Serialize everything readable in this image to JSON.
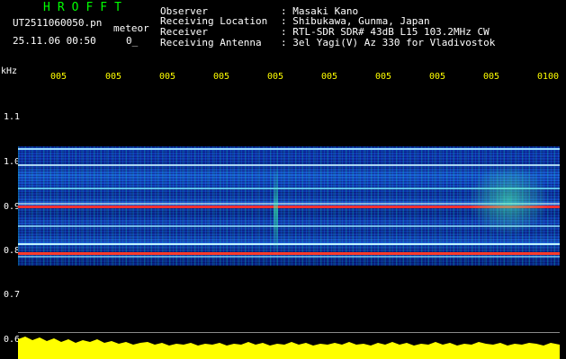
{
  "header": {
    "app_name": "HROFFT",
    "filename": "UT2511060050.pn",
    "mode": "meteor",
    "timestamp": "25.11.06 00:50",
    "count": "0_"
  },
  "station": {
    "rows": [
      {
        "label": "Observer",
        "value": ": Masaki Kano"
      },
      {
        "label": "Receiving Location",
        "value": ": Shibukawa, Gunma, Japan"
      },
      {
        "label": "Receiver",
        "value": ": RTL-SDR SDR# 43dB L15 103.2MHz CW"
      },
      {
        "label": "Receiving Antenna",
        "value": ": 3el Yagi(V) Az 330 for Vladivostok"
      }
    ]
  },
  "freq_axis": {
    "unit": "kHz",
    "ticks": [
      "1.1",
      "1.0",
      "0.9",
      "0.8",
      "0.7",
      "0.6"
    ]
  },
  "time_axis": {
    "ticks": [
      "005",
      "005",
      "005",
      "005",
      "005",
      "005",
      "005",
      "005",
      "005",
      "0100"
    ]
  },
  "colors": {
    "brand": "#00ff00",
    "tick_text": "#ffff00",
    "amplitude": "#ffff00",
    "carrier": "#ff3030"
  }
}
